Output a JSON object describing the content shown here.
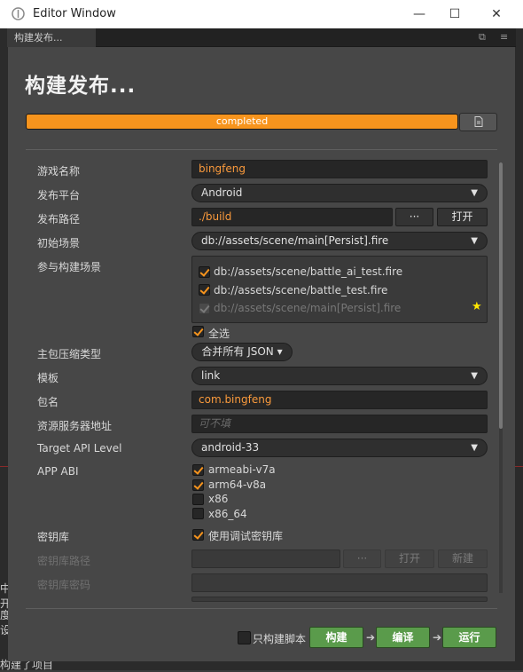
{
  "window": {
    "title": "Editor Window",
    "controls": [
      "—",
      "☐",
      "✕"
    ]
  },
  "tab": {
    "label": "构建发布..."
  },
  "page": {
    "heading": "构建发布...",
    "progress": {
      "label": "completed",
      "value": 1.0
    }
  },
  "form": {
    "game_name": {
      "label": "游戏名称",
      "value": "bingfeng"
    },
    "platform": {
      "label": "发布平台",
      "value": "Android"
    },
    "build_path": {
      "label": "发布路径",
      "value": "./build",
      "browse_label": "···",
      "open_label": "打开"
    },
    "start_scene": {
      "label": "初始场景",
      "value": "db://assets/scene/main[Persist].fire"
    },
    "scenes": {
      "label": "参与构建场景",
      "items": [
        {
          "path": "db://assets/scene/battle_ai_test.fire"
        },
        {
          "path": "db://assets/scene/battle_test.fire"
        },
        {
          "path": "db://assets/scene/main[Persist].fire"
        }
      ],
      "select_all_label": "全选"
    },
    "compression": {
      "label": "主包压缩类型",
      "value": "合并所有 JSON ▾"
    },
    "template": {
      "label": "模板",
      "value": "link"
    },
    "package_name": {
      "label": "包名",
      "value": "com.bingfeng"
    },
    "resource_server": {
      "label": "资源服务器地址",
      "placeholder": "可不填"
    },
    "api_level": {
      "label": "Target API Level",
      "value": "android-33"
    },
    "app_abi": {
      "label": "APP ABI",
      "options": [
        {
          "name": "armeabi-v7a",
          "checked": true
        },
        {
          "name": "arm64-v8a",
          "checked": true
        },
        {
          "name": "x86",
          "checked": false
        },
        {
          "name": "x86_64",
          "checked": false
        }
      ]
    },
    "keystore": {
      "label": "密钥库",
      "checkbox_label": "使用调试密钥库"
    },
    "keystore_path": {
      "label": "密钥库路径",
      "browse_label": "···",
      "open_label": "打开",
      "new_label": "新建"
    },
    "keystore_password": {
      "label": "密钥库密码"
    }
  },
  "footer": {
    "script_only_label": "只构建脚本",
    "build_label": "构建",
    "compile_label": "编译",
    "run_label": "运行"
  },
  "background": {
    "line1": "中开",
    "line2": "度设",
    "line3": "构建了项目"
  },
  "colors": {
    "accent": "#f7941d",
    "green": "#5a9b4b",
    "star": "#ffe600"
  },
  "icons": {
    "doc": "document-icon",
    "star": "star-icon",
    "app": "app-icon"
  }
}
